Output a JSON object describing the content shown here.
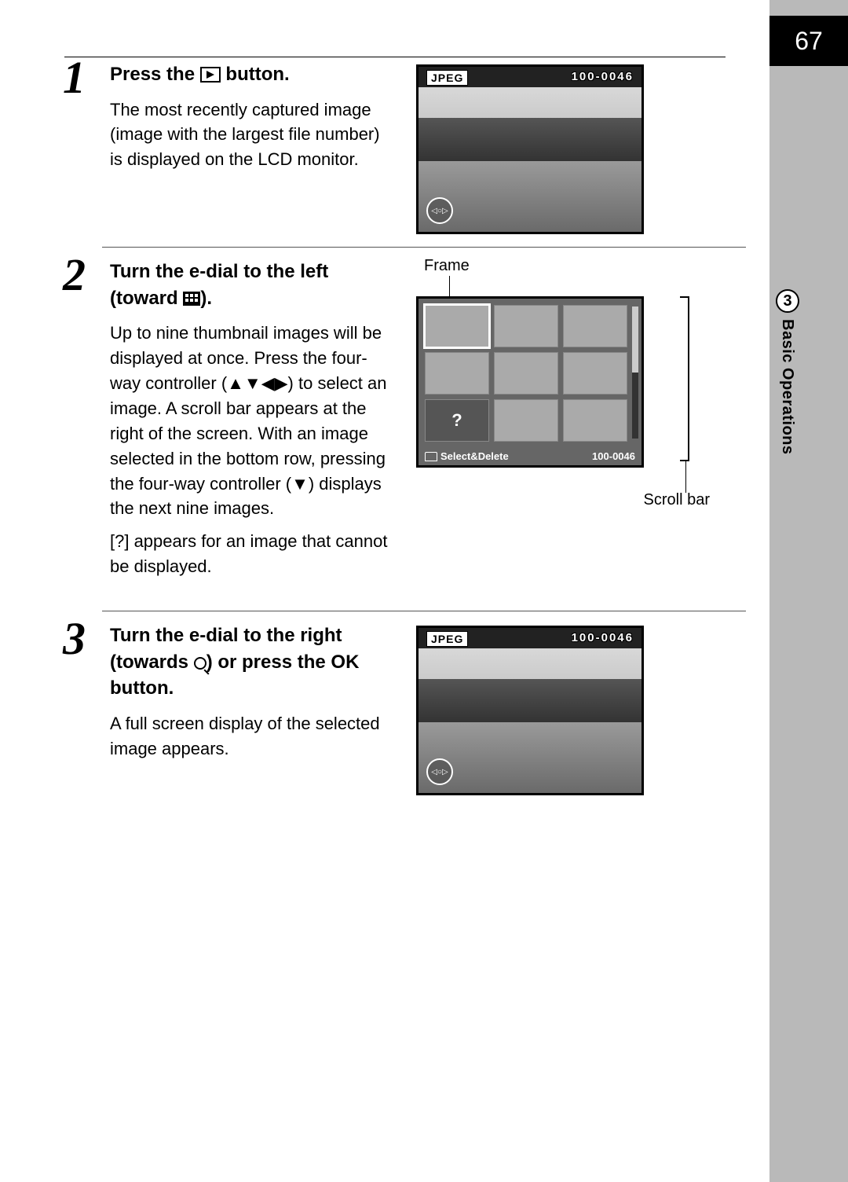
{
  "page_number": "67",
  "section": {
    "number": "3",
    "label": "Basic Operations"
  },
  "steps": [
    {
      "num": "1",
      "title_before": "Press the ",
      "title_after": " button.",
      "body": [
        "The most recently captured image (image with the largest file number) is displayed on the LCD monitor."
      ],
      "lcd": {
        "format": "JPEG",
        "file_number": "100-0046"
      }
    },
    {
      "num": "2",
      "title_before": "Turn the e-dial to the left (toward ",
      "title_after": ").",
      "body": [
        "Up to nine thumbnail images will be displayed at once. Press the four-way controller (▲▼◀▶) to select an image. A scroll bar appears at the right of the screen. With an image selected in the bottom row, pressing the four-way controller (▼) displays the next nine images.",
        "[?] appears for an image that cannot be displayed."
      ],
      "annotations": {
        "frame": "Frame",
        "scroll": "Scroll bar"
      },
      "grid_footer": {
        "action": "Select&Delete",
        "file_number": "100-0046",
        "question": "?"
      }
    },
    {
      "num": "3",
      "title_before": "Turn the e-dial to the right (towards ",
      "title_mid": ") or press the ",
      "title_ok": "OK",
      "title_after": " button.",
      "body": [
        "A full screen display of the selected image appears."
      ],
      "lcd": {
        "format": "JPEG",
        "file_number": "100-0046"
      }
    }
  ]
}
